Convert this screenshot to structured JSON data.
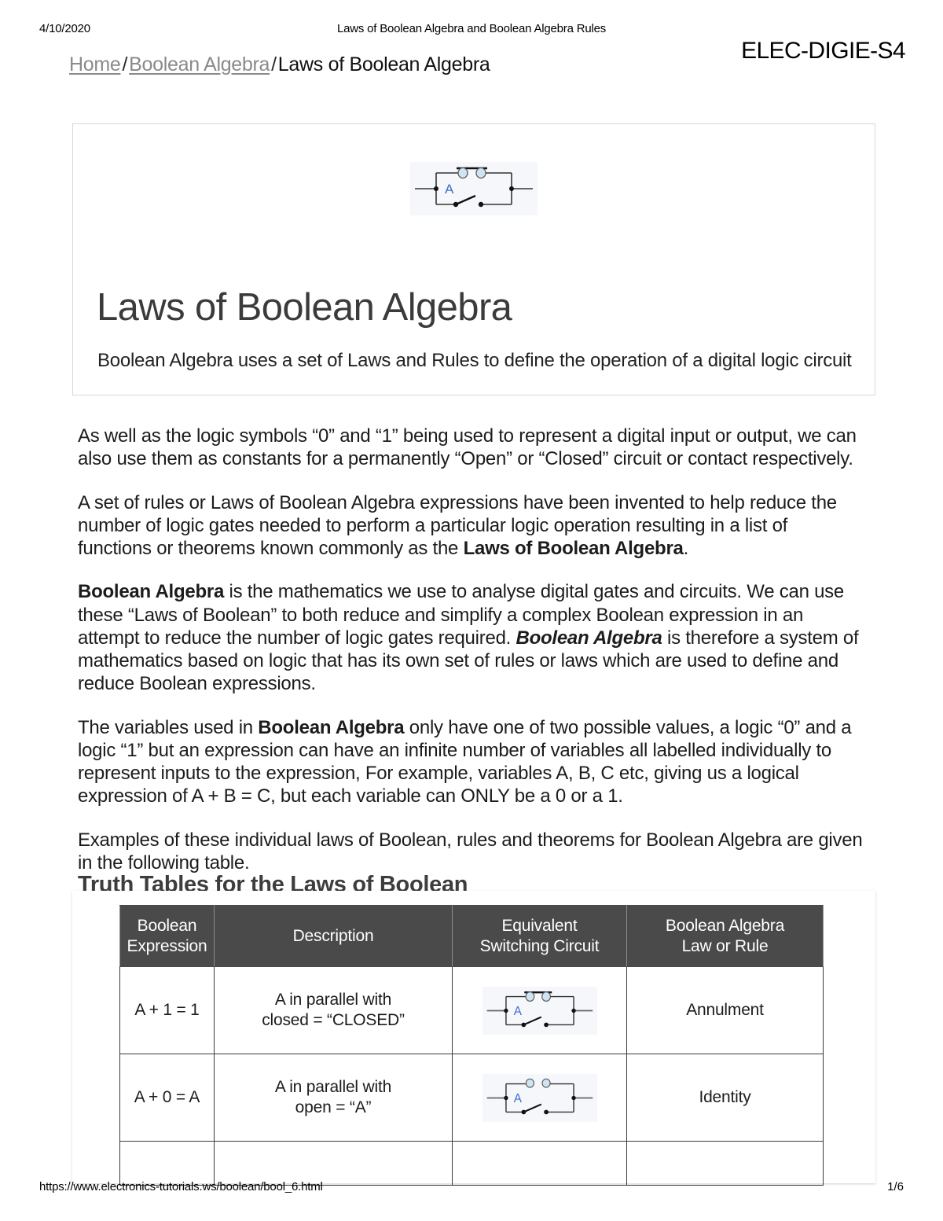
{
  "print_header": {
    "date": "4/10/2020",
    "title": "Laws of Boolean Algebra and Boolean Algebra Rules",
    "doc_code": "ELEC-DIGIE-S4"
  },
  "breadcrumb": {
    "home": "Home",
    "sep1": "/",
    "category": "Boolean Algebra",
    "sep2": "/",
    "current": "Laws of Boolean Algebra"
  },
  "hero": {
    "title": "Laws of Boolean Algebra",
    "subtitle": "Boolean Algebra uses a set of Laws and Rules to define the operation of a digital logic circuit",
    "figure_label": "A",
    "figure_state": "closed-parallel-switch"
  },
  "prose": {
    "p1": "As well as the logic symbols “0” and “1” being used to represent a digital input or output, we can also use them as constants for a permanently “Open” or “Closed” circuit or contact respectively.",
    "p2_a": "A set of rules or Laws of Boolean Algebra expressions have been invented to help reduce the number of logic gates needed to perform a particular logic operation resulting in a list of functions or theorems known commonly as the ",
    "p2_bold": "Laws of Boolean Algebra",
    "p2_b": ".",
    "p3_bold1": "Boolean Algebra",
    "p3_a": " is the mathematics we use to analyse digital gates and circuits. We can use these “Laws of Boolean” to both reduce and simplify a complex Boolean expression in an attempt to reduce the number of logic gates required. ",
    "p3_bolditalic": "Boolean Algebra",
    "p3_b": " is therefore a system of mathematics based on logic that has its own set of rules or laws which are used to define and reduce Boolean expressions.",
    "p4_a": "The variables used in ",
    "p4_bold": "Boolean Algebra",
    "p4_b": " only have one of two possible values, a logic “0” and a logic “1” but an expression can have an infinite number of variables all labelled individually to represent inputs to the expression, For example, variables A, B, C etc, giving us a logical expression of A + B = C, but each variable can ONLY be a 0 or a 1.",
    "p5": "Examples of these individual laws of Boolean, rules and theorems for Boolean Algebra are given in the following table."
  },
  "section_heading": "Truth Tables for the Laws of Boolean",
  "table": {
    "headers": [
      "Boolean\nExpression",
      "Description",
      "Equivalent\nSwitching Circuit",
      "Boolean Algebra\nLaw or Rule"
    ],
    "header_line1": [
      "Boolean",
      "Description",
      "Equivalent",
      "Boolean Algebra"
    ],
    "header_line2": [
      "Expression",
      "",
      "Switching Circuit",
      "Law or Rule"
    ],
    "rows": [
      {
        "expression": "A + 1 = 1",
        "description_line1": "A in parallel with",
        "description_line2": "closed = “CLOSED”",
        "circuit_label": "A",
        "circuit_state": "closed",
        "law": "Annulment"
      },
      {
        "expression": "A + 0 = A",
        "description_line1": "A in parallel with",
        "description_line2": "open = “A”",
        "circuit_label": "A",
        "circuit_state": "open",
        "law": "Identity"
      }
    ]
  },
  "footer": {
    "url": "https://www.electronics-tutorials.ws/boolean/bool_6.html",
    "page": "1/6"
  },
  "colors": {
    "table_header_bg": "#4a4a4a",
    "table_header_text": "#ffffff",
    "link_gray": "#8a8a8a",
    "hero_title": "#3b3b3b",
    "circuit_terminal_fill": "#cfe4f2",
    "circuit_label_blue": "#3b6ecb",
    "circuit_figure_bg": "#f5f7fa"
  }
}
